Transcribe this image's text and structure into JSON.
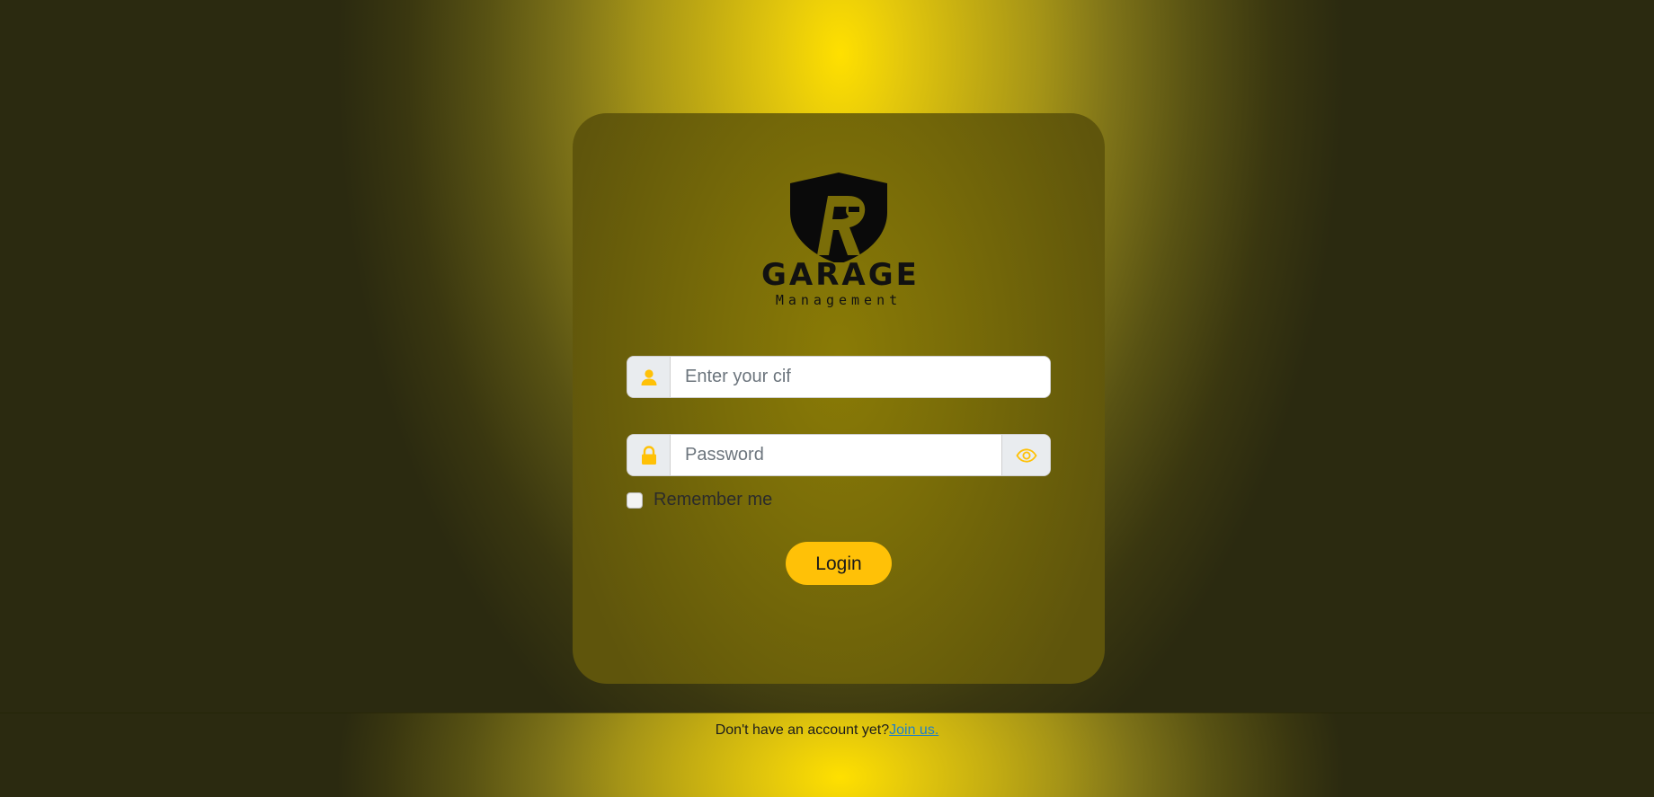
{
  "brand": {
    "name": "GARAGE",
    "subtitle": "Management"
  },
  "form": {
    "cif": {
      "placeholder": "Enter your cif",
      "value": "",
      "icon": "user-icon"
    },
    "password": {
      "placeholder": "Password",
      "value": "",
      "icon": "lock-icon",
      "toggle_icon": "eye-icon"
    },
    "remember": {
      "label": "Remember me",
      "checked": false
    },
    "login_label": "Login"
  },
  "footer": {
    "prompt": "Don't have an account yet?",
    "link_label": "Join us."
  },
  "colors": {
    "accent": "#ffc107",
    "link": "#1f7fc8"
  }
}
